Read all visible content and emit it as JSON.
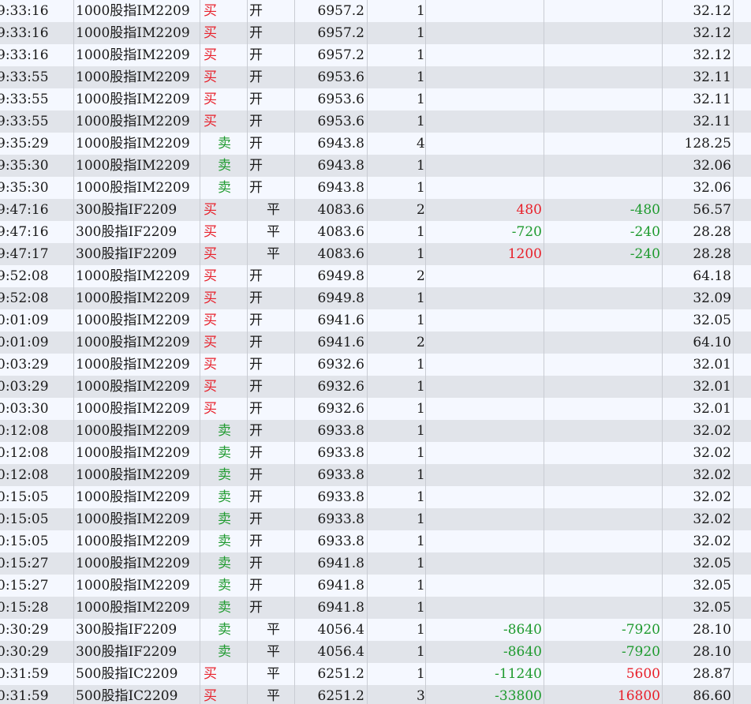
{
  "rows": [
    {
      "time": "9:33:16",
      "name": "1000股指IM2209",
      "side": "买",
      "off": "开",
      "price": "6957.2",
      "qty": "1",
      "pl1": "",
      "pl2": "",
      "fee": "32.12"
    },
    {
      "time": "9:33:16",
      "name": "1000股指IM2209",
      "side": "买",
      "off": "开",
      "price": "6957.2",
      "qty": "1",
      "pl1": "",
      "pl2": "",
      "fee": "32.12"
    },
    {
      "time": "9:33:16",
      "name": "1000股指IM2209",
      "side": "买",
      "off": "开",
      "price": "6957.2",
      "qty": "1",
      "pl1": "",
      "pl2": "",
      "fee": "32.12"
    },
    {
      "time": "9:33:55",
      "name": "1000股指IM2209",
      "side": "买",
      "off": "开",
      "price": "6953.6",
      "qty": "1",
      "pl1": "",
      "pl2": "",
      "fee": "32.11"
    },
    {
      "time": "9:33:55",
      "name": "1000股指IM2209",
      "side": "买",
      "off": "开",
      "price": "6953.6",
      "qty": "1",
      "pl1": "",
      "pl2": "",
      "fee": "32.11"
    },
    {
      "time": "9:33:55",
      "name": "1000股指IM2209",
      "side": "买",
      "off": "开",
      "price": "6953.6",
      "qty": "1",
      "pl1": "",
      "pl2": "",
      "fee": "32.11"
    },
    {
      "time": "9:35:29",
      "name": "1000股指IM2209",
      "side": "卖",
      "off": "开",
      "price": "6943.8",
      "qty": "4",
      "pl1": "",
      "pl2": "",
      "fee": "128.25"
    },
    {
      "time": "9:35:30",
      "name": "1000股指IM2209",
      "side": "卖",
      "off": "开",
      "price": "6943.8",
      "qty": "1",
      "pl1": "",
      "pl2": "",
      "fee": "32.06"
    },
    {
      "time": "9:35:30",
      "name": "1000股指IM2209",
      "side": "卖",
      "off": "开",
      "price": "6943.8",
      "qty": "1",
      "pl1": "",
      "pl2": "",
      "fee": "32.06"
    },
    {
      "time": "9:47:16",
      "name": "300股指IF2209",
      "side": "买",
      "off": "平",
      "price": "4083.6",
      "qty": "2",
      "pl1": "480",
      "pl2": "-480",
      "fee": "56.57"
    },
    {
      "time": "9:47:16",
      "name": "300股指IF2209",
      "side": "买",
      "off": "平",
      "price": "4083.6",
      "qty": "1",
      "pl1": "-720",
      "pl2": "-240",
      "fee": "28.28"
    },
    {
      "time": "9:47:17",
      "name": "300股指IF2209",
      "side": "买",
      "off": "平",
      "price": "4083.6",
      "qty": "1",
      "pl1": "1200",
      "pl2": "-240",
      "fee": "28.28"
    },
    {
      "time": "9:52:08",
      "name": "1000股指IM2209",
      "side": "买",
      "off": "开",
      "price": "6949.8",
      "qty": "2",
      "pl1": "",
      "pl2": "",
      "fee": "64.18"
    },
    {
      "time": "9:52:08",
      "name": "1000股指IM2209",
      "side": "买",
      "off": "开",
      "price": "6949.8",
      "qty": "1",
      "pl1": "",
      "pl2": "",
      "fee": "32.09"
    },
    {
      "time": "0:01:09",
      "name": "1000股指IM2209",
      "side": "买",
      "off": "开",
      "price": "6941.6",
      "qty": "1",
      "pl1": "",
      "pl2": "",
      "fee": "32.05"
    },
    {
      "time": "0:01:09",
      "name": "1000股指IM2209",
      "side": "买",
      "off": "开",
      "price": "6941.6",
      "qty": "2",
      "pl1": "",
      "pl2": "",
      "fee": "64.10"
    },
    {
      "time": "0:03:29",
      "name": "1000股指IM2209",
      "side": "买",
      "off": "开",
      "price": "6932.6",
      "qty": "1",
      "pl1": "",
      "pl2": "",
      "fee": "32.01"
    },
    {
      "time": "0:03:29",
      "name": "1000股指IM2209",
      "side": "买",
      "off": "开",
      "price": "6932.6",
      "qty": "1",
      "pl1": "",
      "pl2": "",
      "fee": "32.01"
    },
    {
      "time": "0:03:30",
      "name": "1000股指IM2209",
      "side": "买",
      "off": "开",
      "price": "6932.6",
      "qty": "1",
      "pl1": "",
      "pl2": "",
      "fee": "32.01"
    },
    {
      "time": "0:12:08",
      "name": "1000股指IM2209",
      "side": "卖",
      "off": "开",
      "price": "6933.8",
      "qty": "1",
      "pl1": "",
      "pl2": "",
      "fee": "32.02"
    },
    {
      "time": "0:12:08",
      "name": "1000股指IM2209",
      "side": "卖",
      "off": "开",
      "price": "6933.8",
      "qty": "1",
      "pl1": "",
      "pl2": "",
      "fee": "32.02"
    },
    {
      "time": "0:12:08",
      "name": "1000股指IM2209",
      "side": "卖",
      "off": "开",
      "price": "6933.8",
      "qty": "1",
      "pl1": "",
      "pl2": "",
      "fee": "32.02"
    },
    {
      "time": "0:15:05",
      "name": "1000股指IM2209",
      "side": "卖",
      "off": "开",
      "price": "6933.8",
      "qty": "1",
      "pl1": "",
      "pl2": "",
      "fee": "32.02"
    },
    {
      "time": "0:15:05",
      "name": "1000股指IM2209",
      "side": "卖",
      "off": "开",
      "price": "6933.8",
      "qty": "1",
      "pl1": "",
      "pl2": "",
      "fee": "32.02"
    },
    {
      "time": "0:15:05",
      "name": "1000股指IM2209",
      "side": "卖",
      "off": "开",
      "price": "6933.8",
      "qty": "1",
      "pl1": "",
      "pl2": "",
      "fee": "32.02"
    },
    {
      "time": "0:15:27",
      "name": "1000股指IM2209",
      "side": "卖",
      "off": "开",
      "price": "6941.8",
      "qty": "1",
      "pl1": "",
      "pl2": "",
      "fee": "32.05"
    },
    {
      "time": "0:15:27",
      "name": "1000股指IM2209",
      "side": "卖",
      "off": "开",
      "price": "6941.8",
      "qty": "1",
      "pl1": "",
      "pl2": "",
      "fee": "32.05"
    },
    {
      "time": "0:15:28",
      "name": "1000股指IM2209",
      "side": "卖",
      "off": "开",
      "price": "6941.8",
      "qty": "1",
      "pl1": "",
      "pl2": "",
      "fee": "32.05"
    },
    {
      "time": "0:30:29",
      "name": "300股指IF2209",
      "side": "卖",
      "off": "平",
      "price": "4056.4",
      "qty": "1",
      "pl1": "-8640",
      "pl2": "-7920",
      "fee": "28.10"
    },
    {
      "time": "0:30:29",
      "name": "300股指IF2209",
      "side": "卖",
      "off": "平",
      "price": "4056.4",
      "qty": "1",
      "pl1": "-8640",
      "pl2": "-7920",
      "fee": "28.10"
    },
    {
      "time": "0:31:59",
      "name": "500股指IC2209",
      "side": "买",
      "off": "平",
      "price": "6251.2",
      "qty": "1",
      "pl1": "-11240",
      "pl2": "5600",
      "fee": "28.87"
    },
    {
      "time": "0:31:59",
      "name": "500股指IC2209",
      "side": "买",
      "off": "平",
      "price": "6251.2",
      "qty": "3",
      "pl1": "-33800",
      "pl2": "16800",
      "fee": "86.60"
    }
  ],
  "colors": {
    "buy": "#e8202a",
    "sell": "#1e9a2e",
    "row_light": "#f5f8ff",
    "row_dark": "#e1e4ea"
  }
}
